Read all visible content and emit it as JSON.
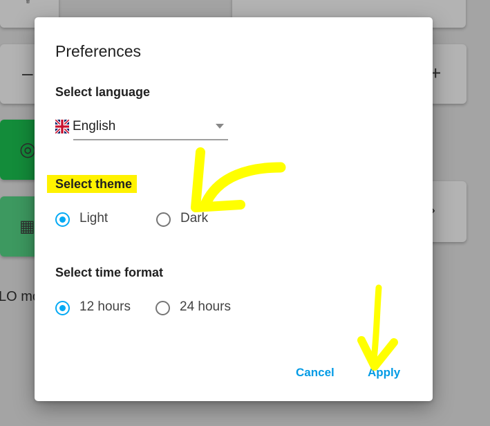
{
  "dialog": {
    "title": "Preferences",
    "language": {
      "label": "Select language",
      "value": "English",
      "flag_icon": "uk-flag-icon"
    },
    "theme": {
      "label": "Select theme",
      "options": [
        {
          "label": "Light",
          "selected": true
        },
        {
          "label": "Dark",
          "selected": false
        }
      ]
    },
    "time_format": {
      "label": "Select time format",
      "options": [
        {
          "label": "12 hours",
          "selected": true
        },
        {
          "label": "24 hours",
          "selected": false
        }
      ]
    },
    "buttons": {
      "cancel": "Cancel",
      "apply": "Apply"
    }
  },
  "background": {
    "partial_text": "LO mo"
  },
  "colors": {
    "accent": "#03a9f4",
    "highlight": "#fff200",
    "annotation": "#ffff00",
    "overlay": "#a4a4a4"
  }
}
